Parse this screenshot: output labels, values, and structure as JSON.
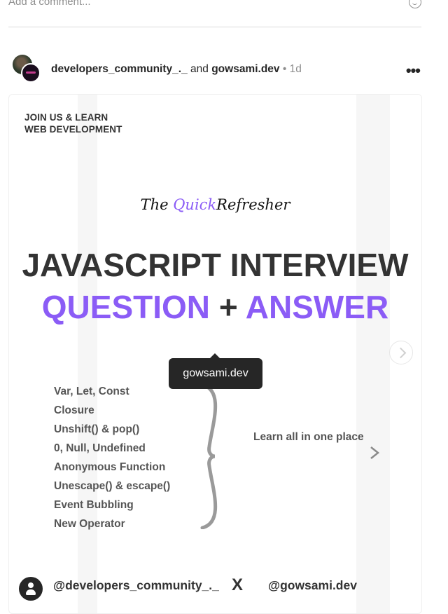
{
  "comment_box": {
    "placeholder": "Add a comment..."
  },
  "post": {
    "author_primary": "developers_community_._",
    "connector": "and",
    "author_secondary": "gowsami.dev",
    "separator": "•",
    "time": "1d"
  },
  "media": {
    "join_line1": "JOIN US & LEARN",
    "join_line2": "WEB DEVELOPMENT",
    "tagline_prefix": "The",
    "tagline_highlight": "Quick",
    "tagline_suffix": "Refresher",
    "headline_line1": "JAVASCRIPT INTERVIEW",
    "headline_word1": "QUESTION",
    "headline_plus": "+",
    "headline_word2": "ANSWER",
    "topics": [
      "Var, Let, Const",
      "Closure",
      "Unshift() & pop()",
      "0, Null, Undefined",
      "Anonymous Function",
      "Unescape() & escape()",
      "Event Bubbling",
      "New Operator"
    ],
    "learn_text": "Learn all in one place",
    "handle_left": "@developers_community_._",
    "x_mark": "X",
    "handle_right": "@gowsami.dev"
  },
  "tooltip": {
    "text": "gowsami.dev"
  },
  "icons": {
    "emoji": "smiley-icon",
    "more": "more-options-icon",
    "next": "chevron-right-icon",
    "user_tag": "user-tag-icon"
  },
  "colors": {
    "accent_purple": "#8b5cf6",
    "text_dark": "#262626",
    "muted": "#8e8e8e"
  }
}
